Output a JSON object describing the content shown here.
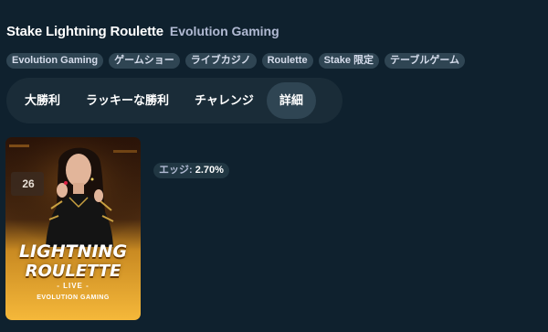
{
  "header": {
    "title": "Stake Lightning Roulette",
    "provider": "Evolution Gaming"
  },
  "tags": [
    "Evolution Gaming",
    "ゲームショー",
    "ライブカジノ",
    "Roulette",
    "Stake 限定",
    "テーブルゲーム"
  ],
  "tabs": [
    {
      "label": "大勝利",
      "active": false
    },
    {
      "label": "ラッキーな勝利",
      "active": false
    },
    {
      "label": "チャレンジ",
      "active": false
    },
    {
      "label": "詳細",
      "active": true
    }
  ],
  "thumbnail": {
    "logo_line1": "LIGHTNING",
    "logo_line2": "ROULETTE",
    "logo_live": "- LIVE -",
    "logo_brand": "EVOLUTION GAMING",
    "sign_number": "26"
  },
  "edge": {
    "label": "エッジ:",
    "value": "2.70%"
  },
  "colors": {
    "background": "#0f212e",
    "tab_bar": "#1a2c38",
    "tag_bg": "#2f4553",
    "muted_text": "#b1bad3"
  }
}
